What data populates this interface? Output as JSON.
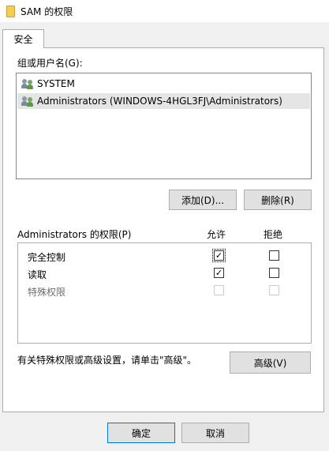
{
  "window": {
    "title": "SAM 的权限",
    "colors": {
      "accent": "#0078d7",
      "panel": "#ffffff",
      "chrome": "#f0f0f0"
    }
  },
  "tabs": [
    {
      "label": "安全"
    }
  ],
  "group_section": {
    "label": "组或用户名(G):",
    "users": [
      {
        "name": "SYSTEM",
        "icon": "users-group-icon",
        "selected": false
      },
      {
        "name": "Administrators (WINDOWS-4HGL3FJ\\Administrators)",
        "icon": "users-group-icon",
        "selected": true
      }
    ]
  },
  "buttons": {
    "add": "添加(D)...",
    "remove": "删除(R)",
    "advanced": "高级(V)",
    "ok": "确定",
    "cancel": "取消"
  },
  "permissions": {
    "header": "Administrators 的权限(P)",
    "allow_header": "允许",
    "deny_header": "拒绝",
    "rows": [
      {
        "name": "完全控制",
        "allow": true,
        "deny": false,
        "enabled": true
      },
      {
        "name": "读取",
        "allow": true,
        "deny": false,
        "enabled": true
      },
      {
        "name": "特殊权限",
        "allow": false,
        "deny": false,
        "enabled": false
      }
    ]
  },
  "advanced_hint": "有关特殊权限或高级设置，请单击\"高级\"。"
}
